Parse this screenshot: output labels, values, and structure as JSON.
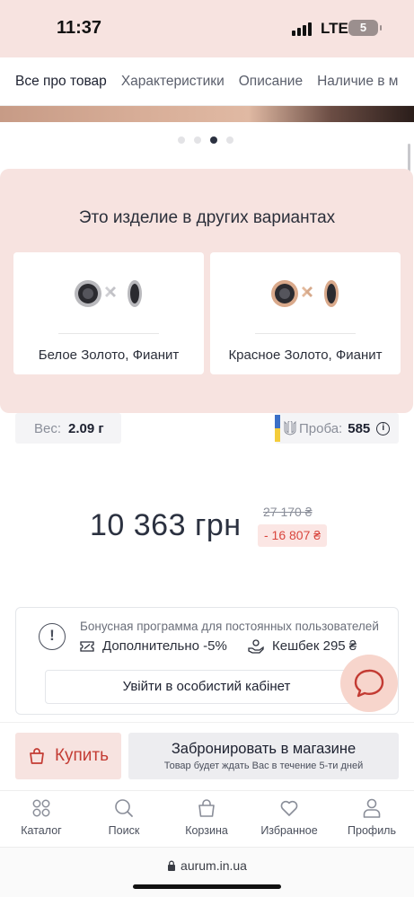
{
  "status_bar": {
    "time": "11:37",
    "network": "LTE",
    "battery": "5"
  },
  "tabs": [
    "Все про товар",
    "Характеристики",
    "Описание",
    "Наличие в м"
  ],
  "carousel": {
    "count": 4,
    "active_index": 2
  },
  "variants": {
    "title": "Это изделие в других вариантах",
    "items": [
      {
        "label": "Белое Золото, Фианит"
      },
      {
        "label": "Красное Золото, Фианит"
      }
    ]
  },
  "specs": {
    "weight_label": "Вес:",
    "weight_value": "2.09 г",
    "probe_label": "Проба:",
    "probe_value": "585",
    "info_icon": "i"
  },
  "price": {
    "current": "10 363 грн",
    "old": "27 170 ₴",
    "discount": "- 16 807 ₴"
  },
  "bonus": {
    "title": "Бонусная программа для постоянных пользователей",
    "extra": "Дополнительно -5%",
    "cashback": "Кешбек 295 ₴",
    "login_button": "Увійти в особистий кабінет",
    "icon": "!"
  },
  "actions": {
    "buy": "Купить",
    "reserve": "Забронировать в магазине",
    "reserve_note": "Товар будет ждать Вас в течение 5-ти дней"
  },
  "nav": [
    "Каталог",
    "Поиск",
    "Корзина",
    "Избранное",
    "Профиль"
  ],
  "url": "aurum.in.ua",
  "colors": {
    "accent": "#c33b33",
    "pink_bg": "#f7e3e0",
    "discount_red": "#d9453d"
  }
}
